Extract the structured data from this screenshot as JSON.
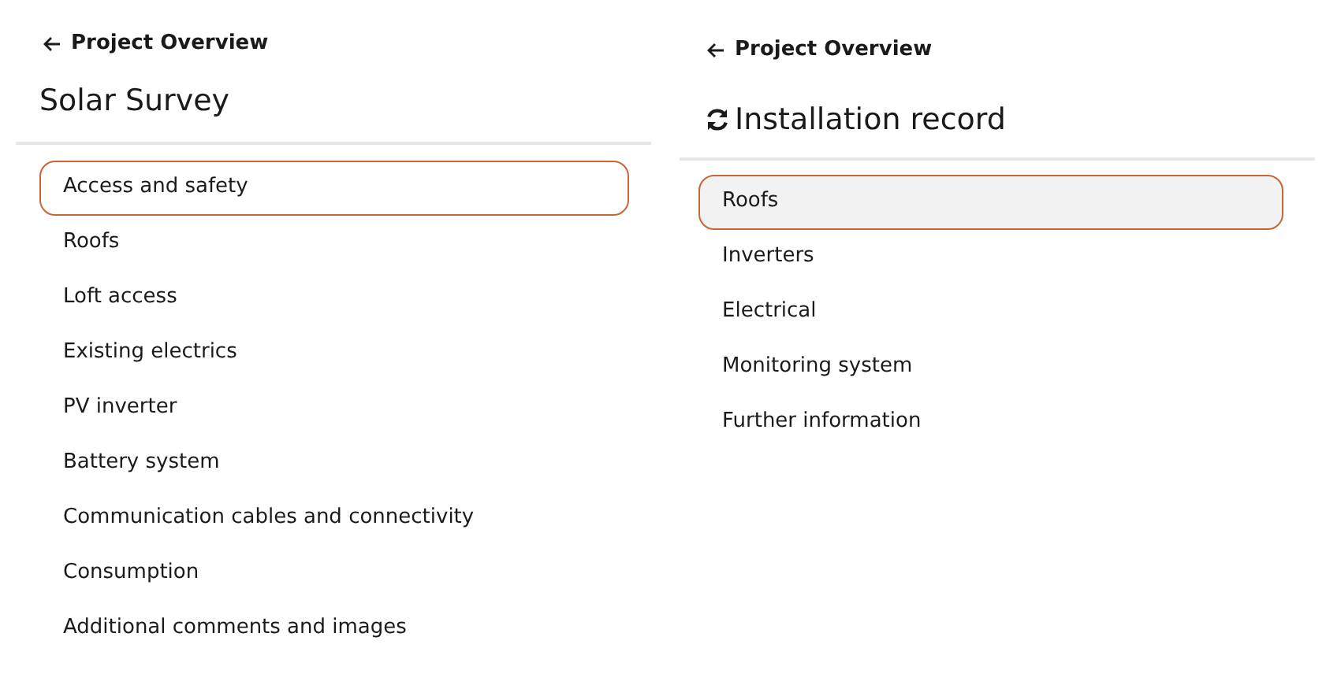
{
  "panels": [
    {
      "back_link": "Project Overview",
      "title": "Solar Survey",
      "title_icon": false,
      "items": [
        {
          "label": "Access and safety",
          "selected": true,
          "hovered": false
        },
        {
          "label": "Roofs",
          "selected": false,
          "hovered": false
        },
        {
          "label": "Loft access",
          "selected": false,
          "hovered": false
        },
        {
          "label": "Existing electrics",
          "selected": false,
          "hovered": false
        },
        {
          "label": "PV inverter",
          "selected": false,
          "hovered": false
        },
        {
          "label": "Battery system",
          "selected": false,
          "hovered": false
        },
        {
          "label": "Communication cables and connectivity",
          "selected": false,
          "hovered": false
        },
        {
          "label": "Consumption",
          "selected": false,
          "hovered": false
        },
        {
          "label": "Additional comments and images",
          "selected": false,
          "hovered": false
        }
      ]
    },
    {
      "back_link": "Project Overview",
      "title": "Installation record",
      "title_icon": true,
      "items": [
        {
          "label": "Roofs",
          "selected": true,
          "hovered": true
        },
        {
          "label": "Inverters",
          "selected": false,
          "hovered": false
        },
        {
          "label": "Electrical",
          "selected": false,
          "hovered": false
        },
        {
          "label": "Monitoring system",
          "selected": false,
          "hovered": false
        },
        {
          "label": "Further information",
          "selected": false,
          "hovered": false
        }
      ]
    }
  ]
}
